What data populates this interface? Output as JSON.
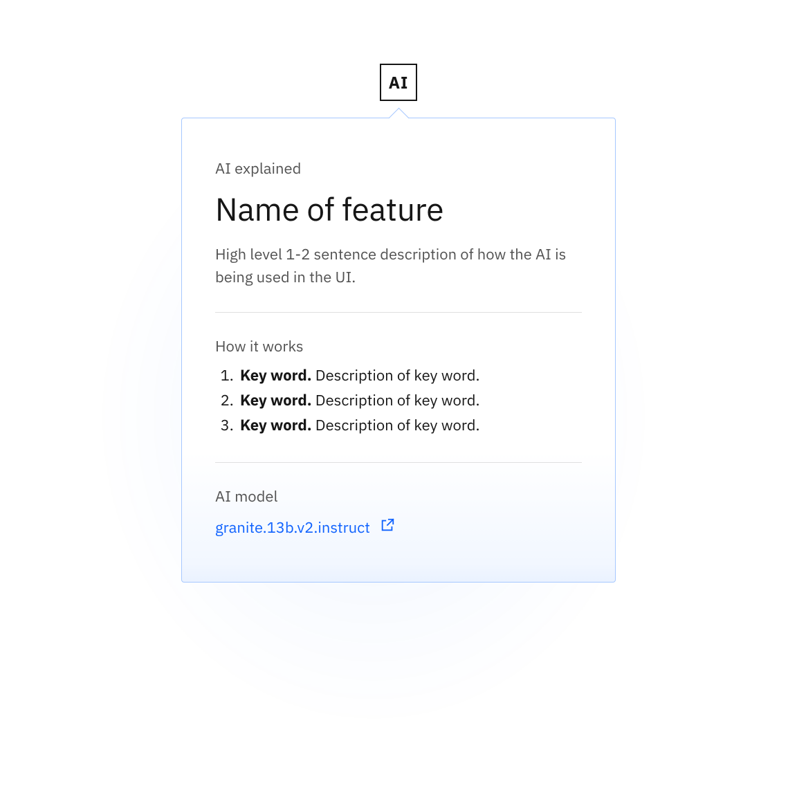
{
  "badge": {
    "label": "AI"
  },
  "popover": {
    "eyebrow": "AI explained",
    "title": "Name of feature",
    "description": "High level 1-2 sentence description of how the AI is being used in the UI.",
    "how_label": "How it works",
    "steps": [
      {
        "keyword": "Key word.",
        "text": " Description of key word."
      },
      {
        "keyword": "Key word.",
        "text": " Description of key word."
      },
      {
        "keyword": "Key word.",
        "text": " Description of key word."
      }
    ],
    "model_label": "AI model",
    "model_link_text": "granite.13b.v2.instruct"
  }
}
